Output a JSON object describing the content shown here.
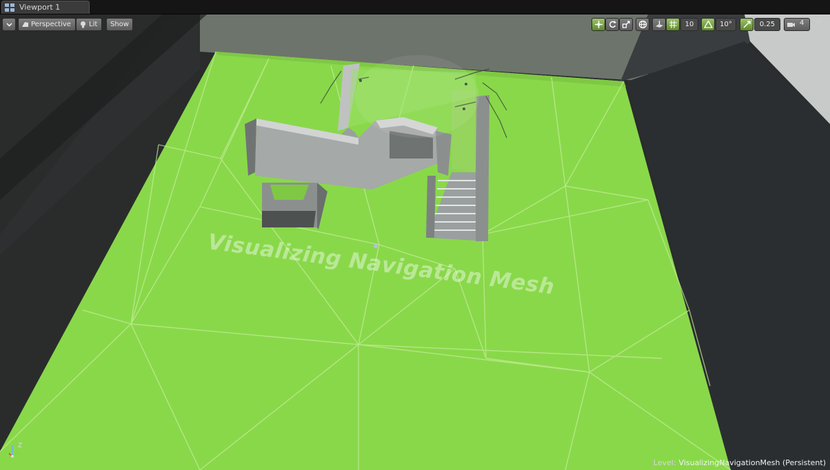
{
  "tab": {
    "title": "Viewport 1",
    "icon": "viewport-grid-icon"
  },
  "toolbar": {
    "view_mode": "Perspective",
    "lighting": "Lit",
    "show": "Show",
    "grid_snap_value": "10",
    "rotation_snap_value": "10°",
    "scale_snap_value": "0.25",
    "camera_speed": "4",
    "maximize_label": "⇱"
  },
  "scene": {
    "overlay_text": "Visualizing Navigation Mesh",
    "navmesh_color": "#89d84a",
    "wall_color": "#9aa0a0"
  },
  "status": {
    "level_label": "Level:",
    "level_name": "VisualizingNavigationMesh (Persistent)"
  },
  "axis": {
    "z_label": "Z"
  }
}
